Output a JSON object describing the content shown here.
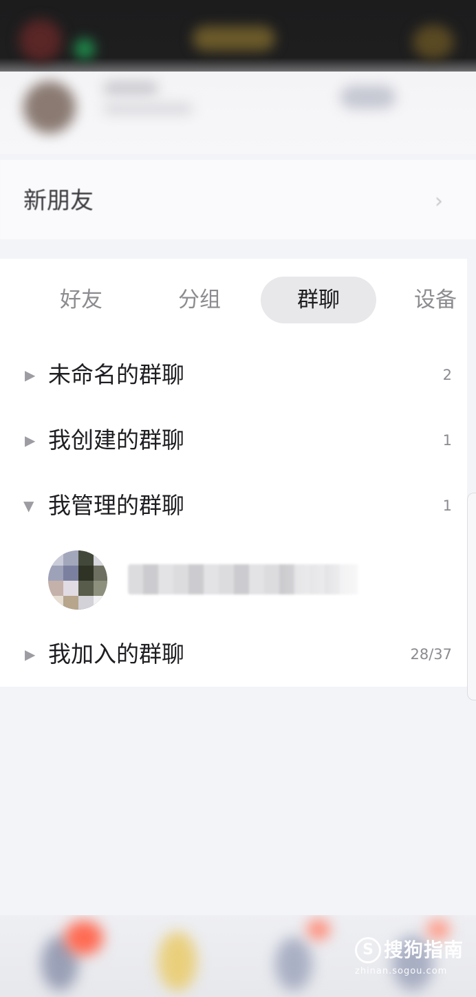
{
  "new_friends": {
    "label": "新朋友",
    "chevron": "›"
  },
  "tabs": [
    {
      "label": "好友",
      "selected": false
    },
    {
      "label": "分组",
      "selected": false
    },
    {
      "label": "群聊",
      "selected": true
    },
    {
      "label": "设备",
      "selected": false
    }
  ],
  "groups": [
    {
      "name": "未命名的群聊",
      "count": "2",
      "expanded": false,
      "arrow": "▶"
    },
    {
      "name": "我创建的群聊",
      "count": "1",
      "expanded": false,
      "arrow": "▶"
    },
    {
      "name": "我管理的群聊",
      "count": "1",
      "expanded": true,
      "arrow": "▼"
    },
    {
      "name": "我加入的群聊",
      "count": "28/37",
      "expanded": false,
      "arrow": "▶"
    }
  ],
  "watermark": {
    "icon": "S",
    "text": "搜狗指南",
    "url": "zhinan.sogou.com"
  },
  "colors": {
    "selected_tab_bg": "#e8e8ea",
    "page_bg": "#f3f4f8",
    "panel_bg": "#ffffff"
  }
}
